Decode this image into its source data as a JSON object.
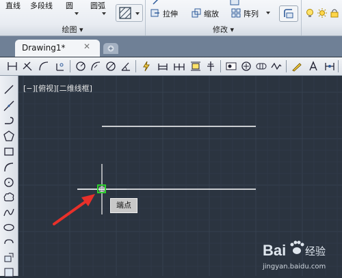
{
  "ribbon": {
    "draw_tools": [
      {
        "label": "直线"
      },
      {
        "label": "多段线"
      },
      {
        "label": "圆"
      },
      {
        "label": "圆弧"
      }
    ],
    "modify_tools": [
      {
        "label": "拉伸"
      },
      {
        "label": "缩放"
      },
      {
        "label": "阵列"
      }
    ],
    "groups": {
      "draw": "绘图 ▾",
      "modify": "修改 ▾"
    }
  },
  "tabs": [
    {
      "label": "Drawing1*",
      "close": "✕",
      "active": true
    }
  ],
  "viewport": {
    "label": "[−][俯视][二维线框]"
  },
  "snap_tooltip": "端点",
  "watermark": {
    "brand": "Bai",
    "brand2": "经验",
    "url": "jingyan.baidu.com"
  },
  "colors": {
    "canvas_bg": "#2b3440",
    "grid": "#36414f",
    "snap_marker": "#2ed12e",
    "arrow": "#e8302a",
    "lines": "#ffffff"
  }
}
